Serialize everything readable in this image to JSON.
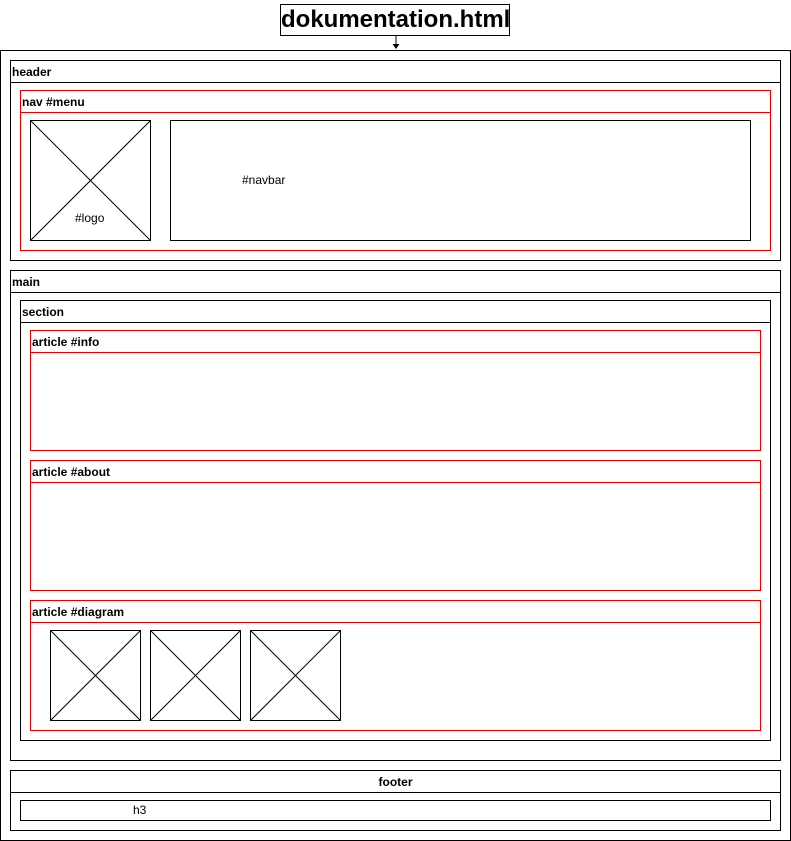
{
  "title": "dokumentation.html",
  "header": {
    "label": "header",
    "nav": {
      "label": "nav #menu",
      "logo_label": "#logo",
      "navbar_label": "#navbar"
    }
  },
  "main": {
    "label": "main",
    "section": {
      "label": "section",
      "articles": [
        {
          "label": "article #info"
        },
        {
          "label": "article #about"
        },
        {
          "label": "article #diagram"
        }
      ]
    }
  },
  "footer": {
    "label": "footer",
    "h3_label": "h3"
  },
  "colors": {
    "outline": "#000000",
    "highlight": "#e00000"
  },
  "icons": [
    "image-placeholder-icon",
    "arrow-down-icon"
  ]
}
